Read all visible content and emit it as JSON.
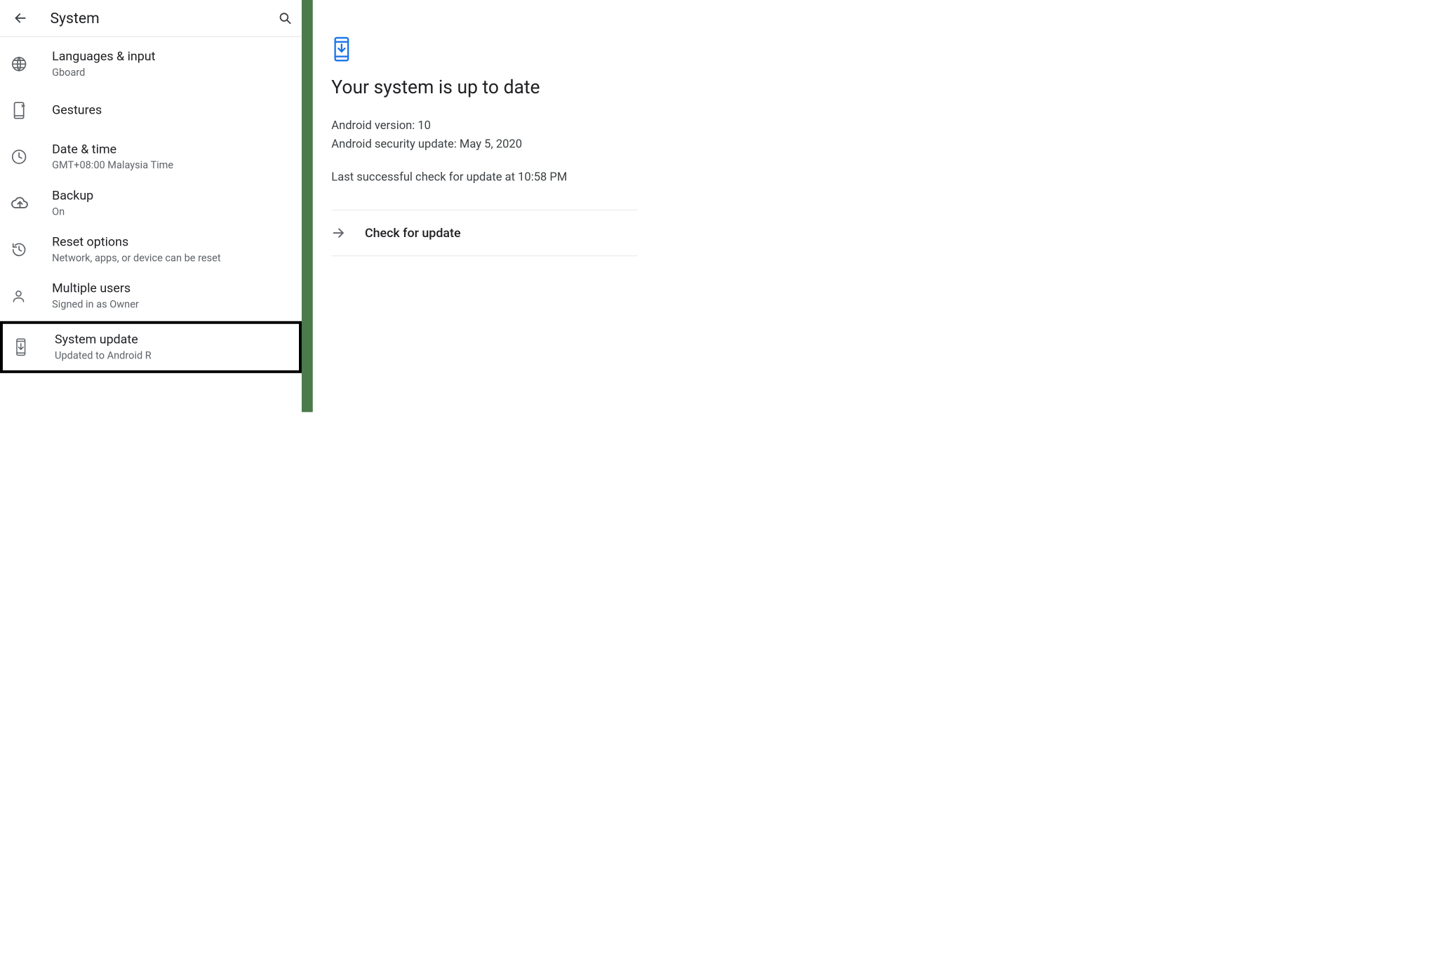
{
  "left": {
    "title": "System",
    "items": [
      {
        "label": "Languages & input",
        "sub": "Gboard"
      },
      {
        "label": "Gestures",
        "sub": ""
      },
      {
        "label": "Date & time",
        "sub": "GMT+08:00 Malaysia Time"
      },
      {
        "label": "Backup",
        "sub": "On"
      },
      {
        "label": "Reset options",
        "sub": "Network, apps, or device can be reset"
      },
      {
        "label": "Multiple users",
        "sub": "Signed in as Owner"
      },
      {
        "label": "System update",
        "sub": "Updated to Android R"
      }
    ]
  },
  "right": {
    "headline": "Your system is up to date",
    "android_version_line": "Android version: 10",
    "security_update_line": "Android security update: May 5, 2020",
    "last_check_line": "Last successful check for update at 10:58 PM",
    "check_label": "Check for update"
  }
}
